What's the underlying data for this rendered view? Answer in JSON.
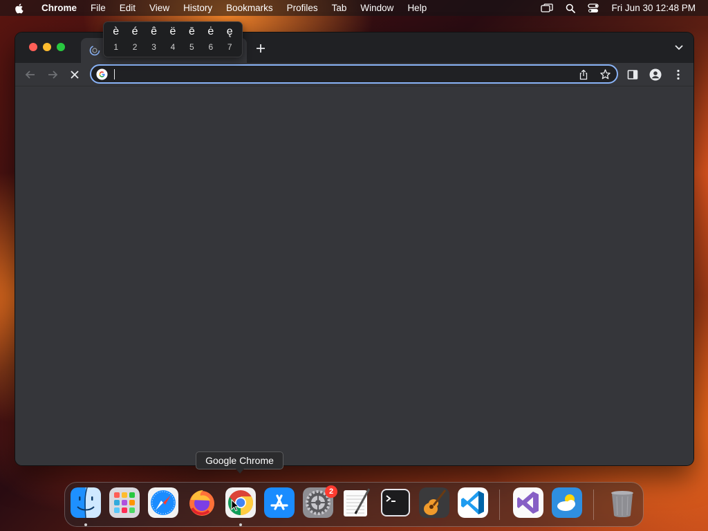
{
  "menubar": {
    "app_name": "Chrome",
    "items": [
      "File",
      "Edit",
      "View",
      "History",
      "Bookmarks",
      "Profiles",
      "Tab",
      "Window",
      "Help"
    ],
    "clock": "Fri Jun 30  12:48 PM",
    "status_icons": [
      "screen-mirroring-icon",
      "spotlight-search-icon",
      "control-center-icon"
    ]
  },
  "accent_popup": {
    "options": [
      {
        "char": "è",
        "key": "1"
      },
      {
        "char": "é",
        "key": "2"
      },
      {
        "char": "ê",
        "key": "3"
      },
      {
        "char": "ë",
        "key": "4"
      },
      {
        "char": "ē",
        "key": "5"
      },
      {
        "char": "ė",
        "key": "6"
      },
      {
        "char": "ę",
        "key": "7"
      }
    ]
  },
  "browser": {
    "tab": {
      "favicon": "loading-spinner-icon",
      "title": ""
    },
    "omnibox": {
      "value": "",
      "placeholder": ""
    },
    "toolbar_icons": [
      "back-arrow-icon",
      "forward-arrow-icon",
      "stop-loading-icon",
      "share-icon",
      "bookmark-star-icon",
      "side-panel-icon",
      "profile-icon",
      "more-menu-icon"
    ]
  },
  "dock": {
    "tooltip": "Google Chrome",
    "apps": [
      {
        "name": "Finder",
        "running": true
      },
      {
        "name": "Launchpad",
        "running": false
      },
      {
        "name": "Safari",
        "running": false
      },
      {
        "name": "Firefox",
        "running": false
      },
      {
        "name": "Google Chrome",
        "running": true
      },
      {
        "name": "App Store",
        "running": false
      },
      {
        "name": "System Settings",
        "running": false,
        "badge": "2"
      },
      {
        "name": "TextEdit",
        "running": false
      },
      {
        "name": "Terminal",
        "running": false
      },
      {
        "name": "GarageBand",
        "running": false
      },
      {
        "name": "Visual Studio Code",
        "running": false
      },
      {
        "name": "Visual Studio",
        "running": false
      },
      {
        "name": "Weather",
        "running": false
      },
      {
        "name": "Trash",
        "running": false
      }
    ]
  }
}
